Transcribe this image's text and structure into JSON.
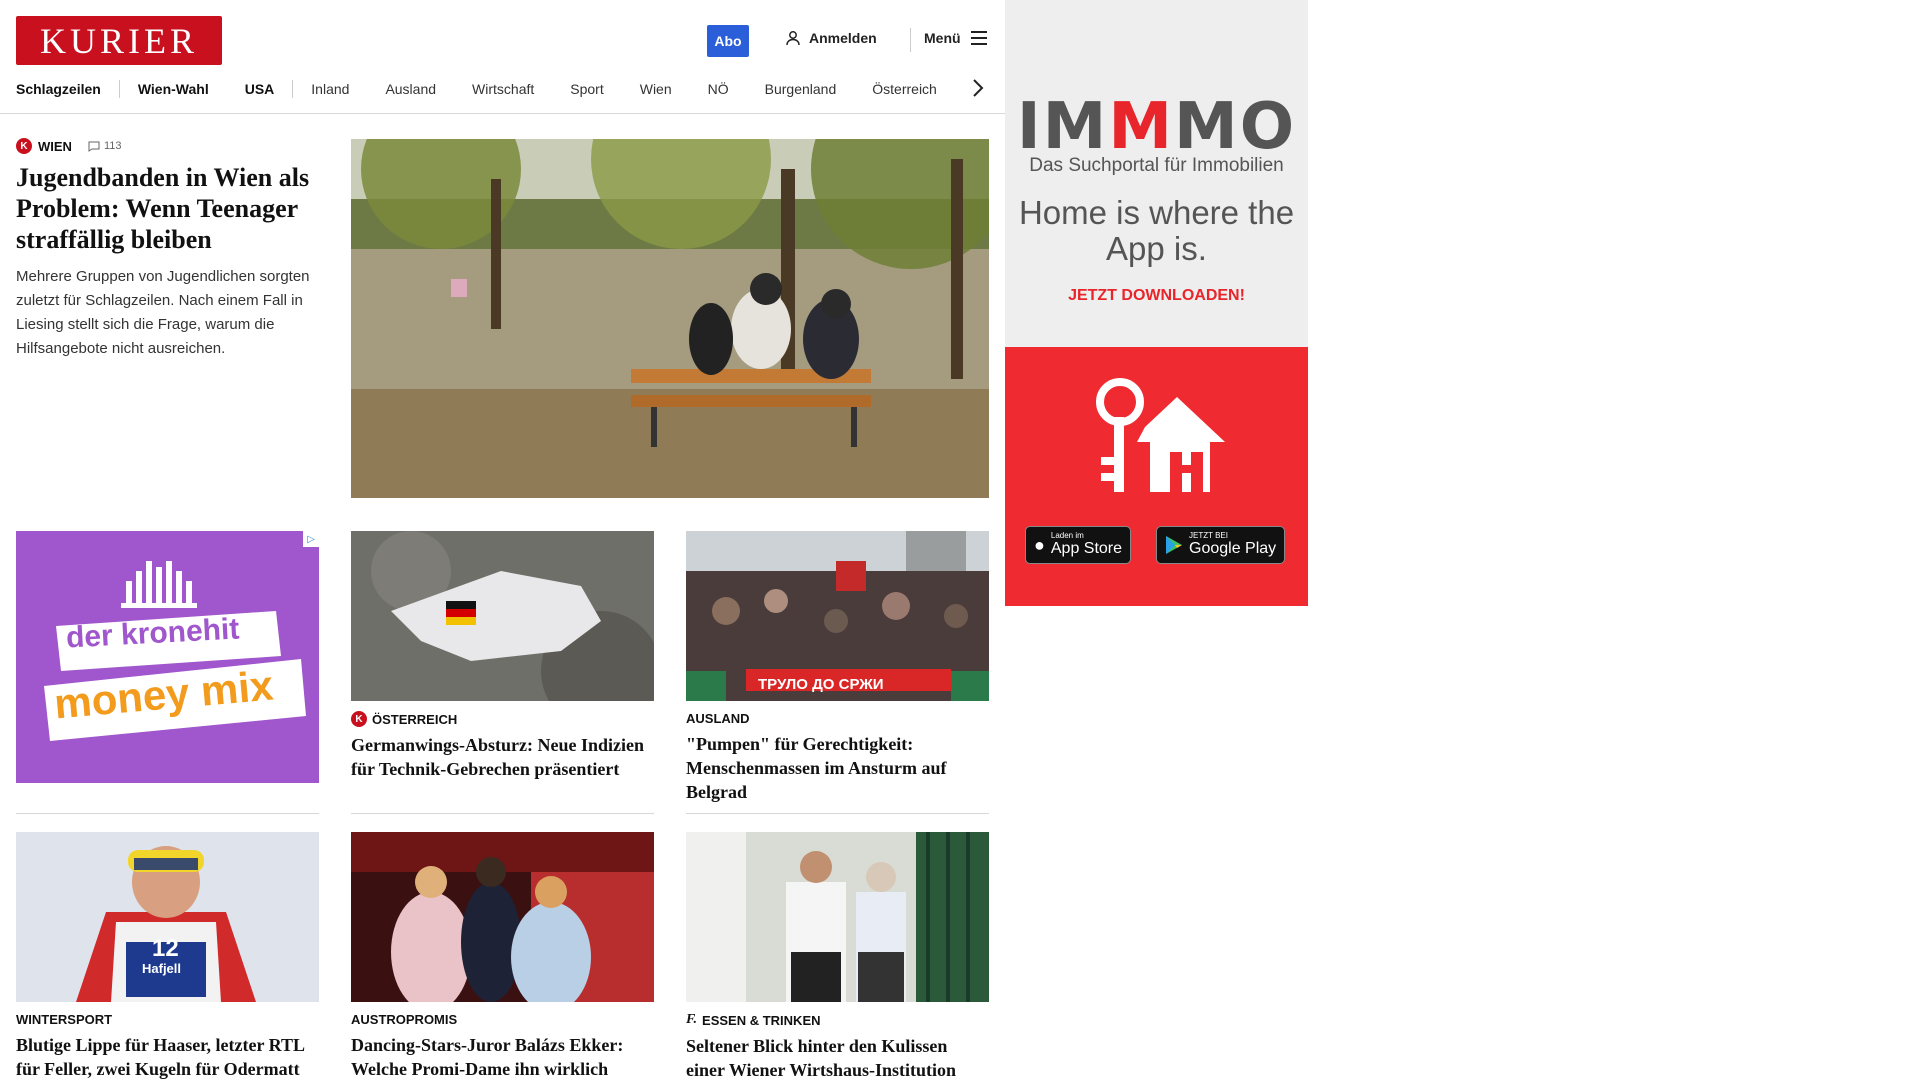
{
  "header": {
    "logo": "KURIER",
    "abo": "Abo",
    "login": "Anmelden",
    "menu": "Menü"
  },
  "nav": {
    "items": [
      "Schlagzeilen",
      "Wien-Wahl",
      "USA",
      "Inland",
      "Ausland",
      "Wirtschaft",
      "Sport",
      "Wien",
      "NÖ",
      "Burgenland",
      "Österreich"
    ]
  },
  "lead": {
    "kicker": "WIEN",
    "comments": "113",
    "title": "Jugendbanden in Wien als Problem: Wenn Teenager straffällig bleiben",
    "teaser": "Mehrere Gruppen von Jugendlichen sorgten zuletzt für Schlagzeilen. Nach einem Fall in Liesing stellt sich die Frage, warum die Hilfsangebote nicht ausreichen."
  },
  "ad_left": {
    "line1": "der kronehit",
    "line2": "money mix"
  },
  "cards": [
    {
      "kicker": "ÖSTERREICH",
      "title": "Germanwings-Absturz: Neue Indizien für Technik-Gebrechen präsentiert"
    },
    {
      "kicker": "AUSLAND",
      "title": "\"Pumpen\" für Gerechtigkeit: Menschenmassen im Ansturm auf Belgrad"
    },
    {
      "kicker": "WINTERSPORT",
      "title": "Blutige Lippe für Haaser, letzter RTL für Feller, zwei Kugeln für Odermatt"
    },
    {
      "kicker": "AUSTROPROMIS",
      "title": "Dancing-Stars-Juror Balázs Ekker: Welche Promi-Dame ihn wirklich überrascht hat"
    },
    {
      "kicker": "ESSEN & TRINKEN",
      "title": "Seltener Blick hinter den Kulissen einer Wiener Wirtshaus-Institution"
    }
  ],
  "side_ad": {
    "brand_a": "IM",
    "brand_b": "M",
    "brand_c": "MO",
    "subtitle": "Das Suchportal für Immobilien",
    "slogan": "Home is where the App is.",
    "cta": "JETZT DOWNLOADEN!",
    "appstore_small": "Laden im",
    "appstore_big": "App Store",
    "gplay_small": "JETZT BEI",
    "gplay_big": "Google Play"
  },
  "photo_texts": {
    "protest_banner": "ТРУЛО ДО СРЖИ",
    "ski_bib": "12",
    "ski_bib_name": "Hafjell"
  }
}
